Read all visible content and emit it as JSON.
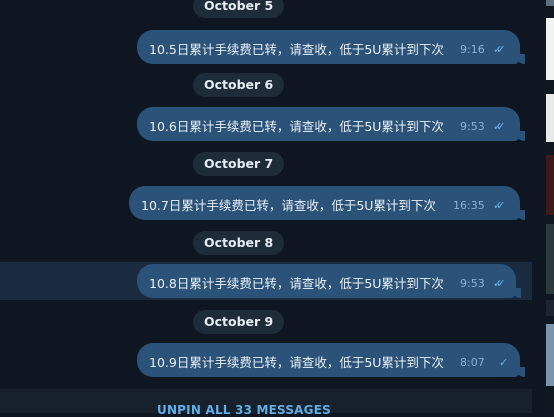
{
  "messages": [
    {
      "date": "October 5",
      "text": "10.5日累计手续费已转，请查收，低于5U累计到下次",
      "time": "9:16",
      "status": "read"
    },
    {
      "date": "October 6",
      "text": "10.6日累计手续费已转，请查收，低于5U累计到下次",
      "time": "9:53",
      "status": "read"
    },
    {
      "date": "October 7",
      "text": "10.7日累计手续费已转，请查收，低于5U累计到下次",
      "time": "16:35",
      "status": "read"
    },
    {
      "date": "October 8",
      "text": "10.8日累计手续费已转，请查收，低于5U累计到下次",
      "time": "9:53",
      "status": "read"
    },
    {
      "date": "October 9",
      "text": "10.9日累计手续费已转，请查收，低于5U累计到下次",
      "time": "8:07",
      "status": "sent"
    }
  ],
  "pinned": {
    "unpin_label": "UNPIN ALL 33 MESSAGES"
  },
  "icons": {
    "read": "double-check-icon",
    "sent": "single-check-icon"
  },
  "colors": {
    "background": "#0e1621",
    "bubble": "#2b5278",
    "accent": "#6ab3f3"
  }
}
